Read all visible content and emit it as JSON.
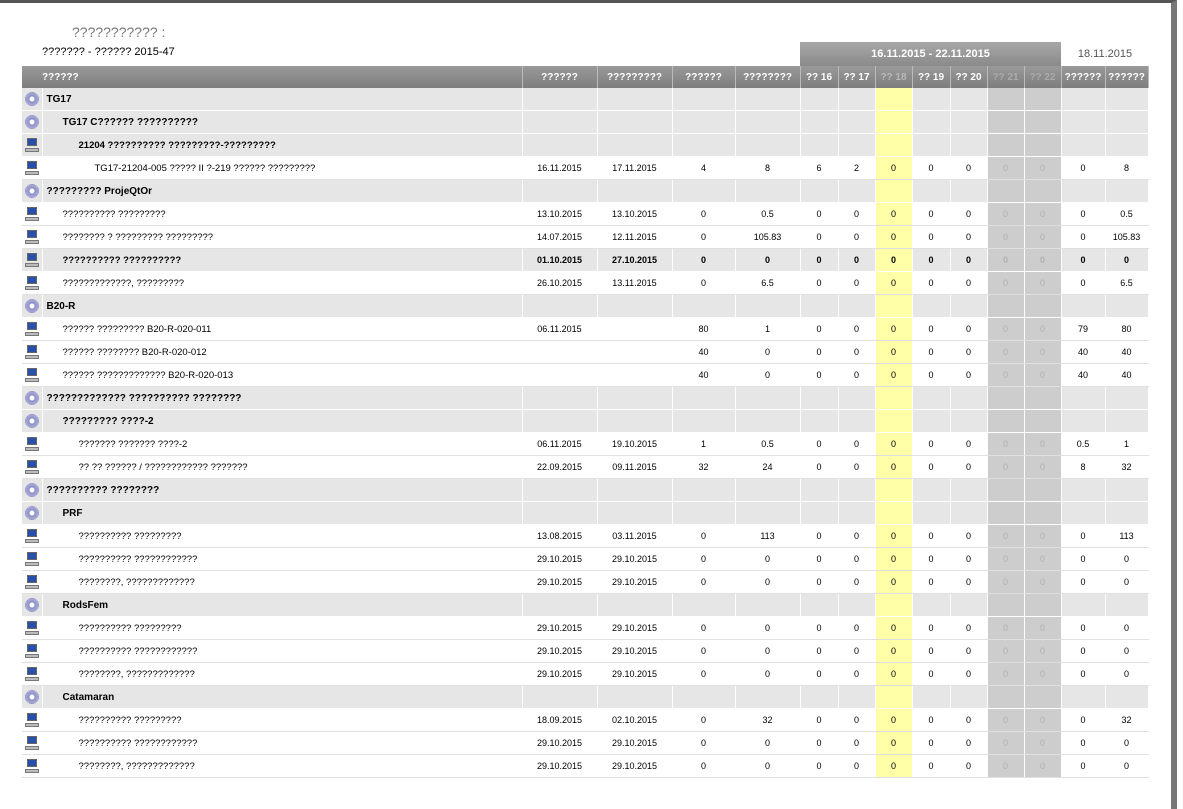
{
  "report": {
    "title": "??????????? :",
    "subtitle": "??????? - ?????? 2015-47",
    "week_range": "16.11.2015 - 22.11.2015",
    "today": "18.11.2015"
  },
  "columns": [
    "??????",
    "??????",
    "?????????",
    "??????",
    "????????",
    "?? 16",
    "?? 17",
    "?? 18",
    "?? 19",
    "?? 20",
    "?? 21",
    "?? 22",
    "??????",
    "??????"
  ],
  "highlight_column": 7,
  "weekend_columns": [
    10,
    11
  ],
  "rows": [
    {
      "type": "group",
      "level": 0,
      "name": "TG17",
      "values": []
    },
    {
      "type": "group",
      "level": 1,
      "name": "TG17 C?????? ??????????",
      "values": []
    },
    {
      "type": "activity",
      "level": 2,
      "name": "21204 ?????????? ?????????-?????????",
      "values": []
    },
    {
      "type": "task",
      "level": 3,
      "name": "TG17-21204-005 ????? II ?-219 ?????? ?????????",
      "values": [
        "16.11.2015",
        "17.11.2015",
        "4",
        "8",
        "6",
        "2",
        "0",
        "0",
        "0",
        "0",
        "0",
        "0",
        "8"
      ]
    },
    {
      "type": "group",
      "level": 0,
      "name": "????????? ProjeQtOr",
      "values": []
    },
    {
      "type": "task",
      "level": 1,
      "name": "?????????? ?????????",
      "values": [
        "13.10.2015",
        "13.10.2015",
        "0",
        "0.5",
        "0",
        "0",
        "0",
        "0",
        "0",
        "0",
        "0",
        "0",
        "0.5"
      ]
    },
    {
      "type": "task",
      "level": 1,
      "name": "???????? ? ????????? ?????????",
      "values": [
        "14.07.2015",
        "12.11.2015",
        "0",
        "105.83",
        "0",
        "0",
        "0",
        "0",
        "0",
        "0",
        "0",
        "0",
        "105.83"
      ]
    },
    {
      "type": "activity",
      "level": 1,
      "name": "?????????? ??????????",
      "values": [
        "01.10.2015",
        "27.10.2015",
        "0",
        "0",
        "0",
        "0",
        "0",
        "0",
        "0",
        "0",
        "0",
        "0",
        "0"
      ]
    },
    {
      "type": "task",
      "level": 1,
      "name": "?????????????, ?????????",
      "values": [
        "26.10.2015",
        "13.11.2015",
        "0",
        "6.5",
        "0",
        "0",
        "0",
        "0",
        "0",
        "0",
        "0",
        "0",
        "6.5"
      ]
    },
    {
      "type": "group",
      "level": 0,
      "name": "B20-R",
      "values": []
    },
    {
      "type": "task",
      "level": 1,
      "name": "?????? ????????? B20-R-020-011",
      "values": [
        "06.11.2015",
        "",
        "80",
        "1",
        "0",
        "0",
        "0",
        "0",
        "0",
        "0",
        "0",
        "79",
        "80"
      ]
    },
    {
      "type": "task",
      "level": 1,
      "name": "?????? ???????? B20-R-020-012",
      "values": [
        "",
        "",
        "40",
        "0",
        "0",
        "0",
        "0",
        "0",
        "0",
        "0",
        "0",
        "40",
        "40"
      ]
    },
    {
      "type": "task",
      "level": 1,
      "name": "?????? ????????????? B20-R-020-013",
      "values": [
        "",
        "",
        "40",
        "0",
        "0",
        "0",
        "0",
        "0",
        "0",
        "0",
        "0",
        "40",
        "40"
      ]
    },
    {
      "type": "group",
      "level": 0,
      "name": "????????????? ?????????? ????????",
      "values": []
    },
    {
      "type": "group",
      "level": 1,
      "name": "????????? ????-2",
      "values": []
    },
    {
      "type": "task",
      "level": 2,
      "name": "??????? ??????? ????-2",
      "values": [
        "06.11.2015",
        "19.10.2015",
        "1",
        "0.5",
        "0",
        "0",
        "0",
        "0",
        "0",
        "0",
        "0",
        "0.5",
        "1"
      ]
    },
    {
      "type": "task",
      "level": 2,
      "name": "?? ?? ?????? / ???????????? ???????",
      "values": [
        "22.09.2015",
        "09.11.2015",
        "32",
        "24",
        "0",
        "0",
        "0",
        "0",
        "0",
        "0",
        "0",
        "8",
        "32"
      ]
    },
    {
      "type": "group",
      "level": 0,
      "name": "?????????? ????????",
      "values": []
    },
    {
      "type": "group",
      "level": 1,
      "name": "PRF",
      "values": []
    },
    {
      "type": "task",
      "level": 2,
      "name": "?????????? ?????????",
      "values": [
        "13.08.2015",
        "03.11.2015",
        "0",
        "113",
        "0",
        "0",
        "0",
        "0",
        "0",
        "0",
        "0",
        "0",
        "113"
      ]
    },
    {
      "type": "task",
      "level": 2,
      "name": "?????????? ????????????",
      "values": [
        "29.10.2015",
        "29.10.2015",
        "0",
        "0",
        "0",
        "0",
        "0",
        "0",
        "0",
        "0",
        "0",
        "0",
        "0"
      ]
    },
    {
      "type": "task",
      "level": 2,
      "name": "????????, ?????????????",
      "values": [
        "29.10.2015",
        "29.10.2015",
        "0",
        "0",
        "0",
        "0",
        "0",
        "0",
        "0",
        "0",
        "0",
        "0",
        "0"
      ]
    },
    {
      "type": "group",
      "level": 1,
      "name": "RodsFem",
      "values": []
    },
    {
      "type": "task",
      "level": 2,
      "name": "?????????? ?????????",
      "values": [
        "29.10.2015",
        "29.10.2015",
        "0",
        "0",
        "0",
        "0",
        "0",
        "0",
        "0",
        "0",
        "0",
        "0",
        "0"
      ]
    },
    {
      "type": "task",
      "level": 2,
      "name": "?????????? ????????????",
      "values": [
        "29.10.2015",
        "29.10.2015",
        "0",
        "0",
        "0",
        "0",
        "0",
        "0",
        "0",
        "0",
        "0",
        "0",
        "0"
      ]
    },
    {
      "type": "task",
      "level": 2,
      "name": "????????, ?????????????",
      "values": [
        "29.10.2015",
        "29.10.2015",
        "0",
        "0",
        "0",
        "0",
        "0",
        "0",
        "0",
        "0",
        "0",
        "0",
        "0"
      ]
    },
    {
      "type": "group",
      "level": 1,
      "name": "Catamaran",
      "values": []
    },
    {
      "type": "task",
      "level": 2,
      "name": "?????????? ?????????",
      "values": [
        "18.09.2015",
        "02.10.2015",
        "0",
        "32",
        "0",
        "0",
        "0",
        "0",
        "0",
        "0",
        "0",
        "0",
        "32"
      ]
    },
    {
      "type": "task",
      "level": 2,
      "name": "?????????? ????????????",
      "values": [
        "29.10.2015",
        "29.10.2015",
        "0",
        "0",
        "0",
        "0",
        "0",
        "0",
        "0",
        "0",
        "0",
        "0",
        "0"
      ]
    },
    {
      "type": "task",
      "level": 2,
      "name": "????????, ?????????????",
      "values": [
        "29.10.2015",
        "29.10.2015",
        "0",
        "0",
        "0",
        "0",
        "0",
        "0",
        "0",
        "0",
        "0",
        "0",
        "0"
      ]
    }
  ]
}
